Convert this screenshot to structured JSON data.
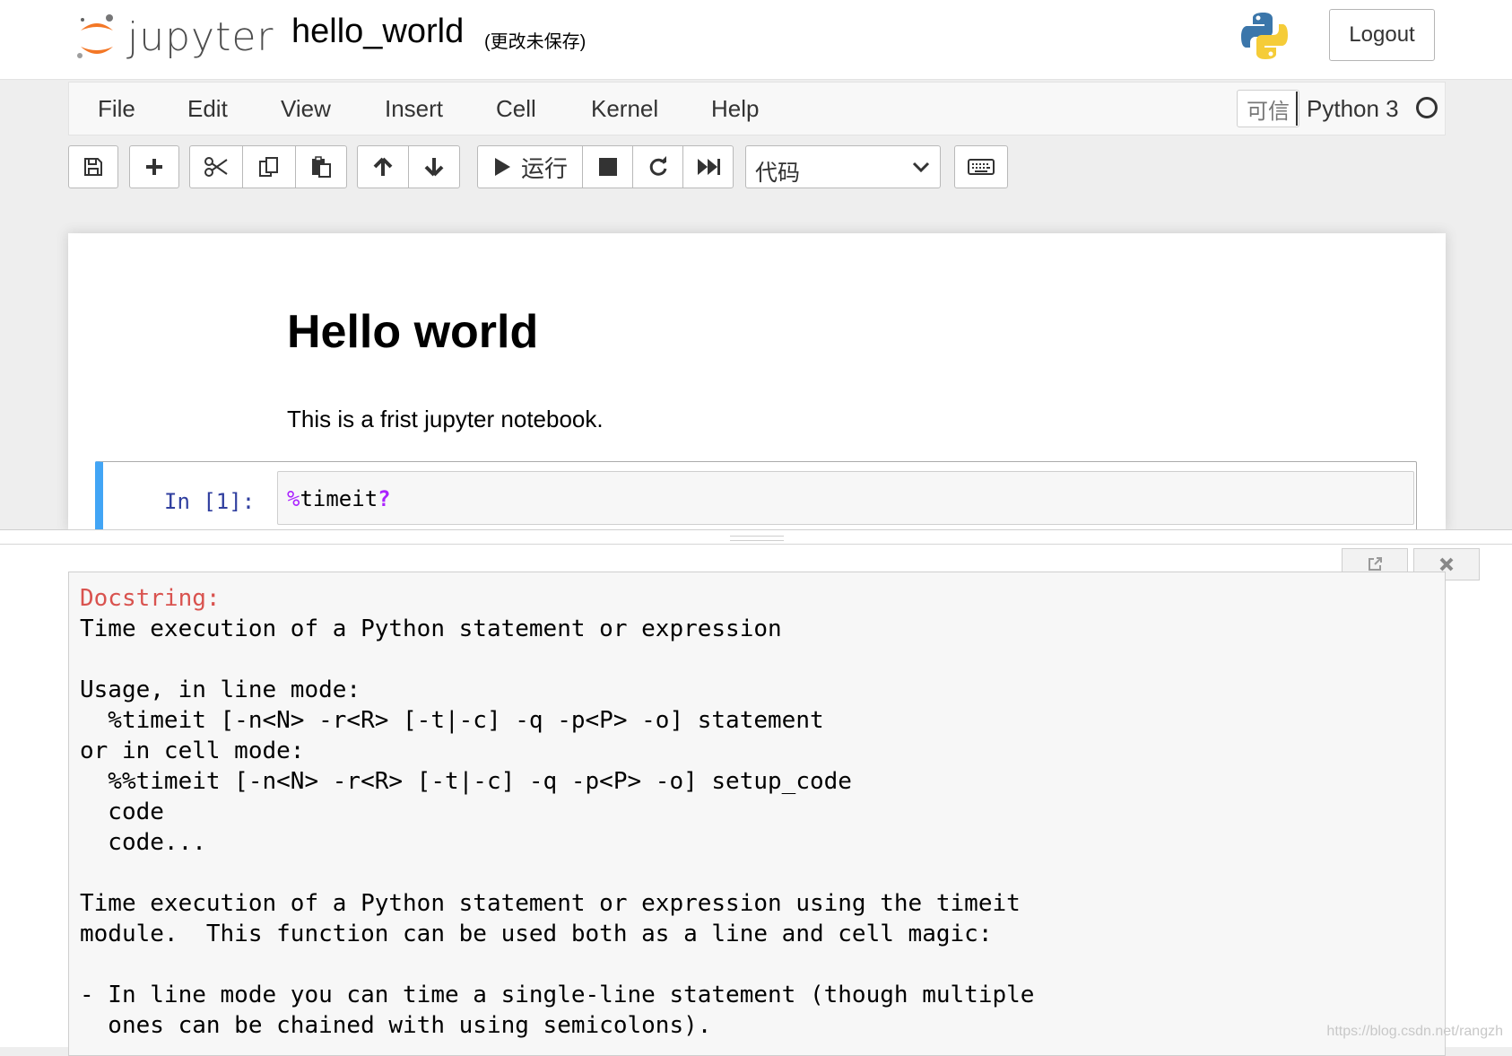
{
  "header": {
    "logo_text": "jupyter",
    "notebook_name": "hello_world",
    "save_status": "(更改未保存)",
    "logout_label": "Logout"
  },
  "menubar": {
    "items": [
      "File",
      "Edit",
      "View",
      "Insert",
      "Cell",
      "Kernel",
      "Help"
    ],
    "trusted_label": "可信",
    "kernel_name": "Python 3"
  },
  "toolbar": {
    "run_label": "运行",
    "cell_type": "代码"
  },
  "notebook": {
    "heading": "Hello world",
    "paragraph": "This is a frist jupyter notebook.",
    "cell_prompt": "In [1]:",
    "code_pct": "%",
    "code_name": "timeit",
    "code_q": "?"
  },
  "pager": {
    "header": "Docstring:",
    "lines": [
      "Time execution of a Python statement or expression",
      "",
      "Usage, in line mode:",
      "  %timeit [-n<N> -r<R> [-t|-c] -q -p<P> -o] statement",
      "or in cell mode:",
      "  %%timeit [-n<N> -r<R> [-t|-c] -q -p<P> -o] setup_code",
      "  code",
      "  code...",
      "",
      "Time execution of a Python statement or expression using the timeit",
      "module.  This function can be used both as a line and cell magic:",
      "",
      "- In line mode you can time a single-line statement (though multiple",
      "  ones can be chained with using semicolons)."
    ]
  },
  "watermark": "https://blog.csdn.net/rangzh",
  "colors": {
    "accent_blue": "#42a5f5",
    "prompt_blue": "#303f9f",
    "magic_purple": "#aa22ff",
    "docstring_red": "#d9534f",
    "jupyter_orange": "#f37726"
  }
}
